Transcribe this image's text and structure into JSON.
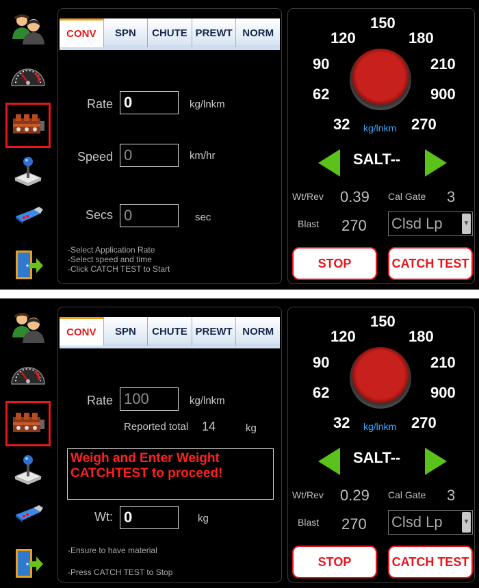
{
  "tabs": [
    "CONV",
    "SPN",
    "CHUTE",
    "PREWT",
    "NORM"
  ],
  "dial": {
    "labels": [
      "150",
      "120",
      "180",
      "90",
      "210",
      "62",
      "900",
      "32",
      "270"
    ],
    "unit": "kg/lnkm"
  },
  "material": "SALT--",
  "screen1": {
    "rate_label": "Rate",
    "rate_value": "0",
    "rate_unit": "kg/lnkm",
    "speed_label": "Speed",
    "speed_value": "0",
    "speed_unit": "km/hr",
    "secs_label": "Secs",
    "secs_value": "0",
    "secs_unit": "sec",
    "hints": [
      "-Select Application Rate",
      "-Select speed and time",
      "-Click CATCH TEST to Start"
    ],
    "wtrev_label": "Wt/Rev",
    "wtrev_value": "0.39",
    "calgate_label": "Cal Gate",
    "calgate_value": "3",
    "blast_label": "Blast",
    "blast_value": "270",
    "mode": "Clsd Lp",
    "stop_label": "STOP",
    "catch_label": "CATCH TEST"
  },
  "screen2": {
    "rate_label": "Rate",
    "rate_value": "100",
    "rate_unit": "kg/lnkm",
    "reported_label": "Reported total",
    "reported_value": "14",
    "reported_unit": "kg",
    "message": [
      "Weigh and Enter Weight",
      "CATCHTEST to proceed!"
    ],
    "wt_label": "Wt:",
    "wt_value": "0",
    "wt_unit": "kg",
    "hints": [
      "-Ensure to have material",
      "-Press CATCH TEST to Stop"
    ],
    "wtrev_label": "Wt/Rev",
    "wtrev_value": "0.29",
    "calgate_label": "Cal Gate",
    "calgate_value": "3",
    "blast_label": "Blast",
    "blast_value": "270",
    "mode": "Clsd Lp",
    "stop_label": "STOP",
    "catch_label": "CATCH TEST"
  },
  "sidebar_icons": [
    "users-icon",
    "speedometer-icon",
    "valve-bank-icon",
    "joystick-icon",
    "usb-drive-icon",
    "exit-door-icon"
  ],
  "colors": {
    "accent_red": "#e8161c",
    "arrow_green": "#5ac21a",
    "unit_blue": "#3aa8ff",
    "knob_red": "#c8201c"
  }
}
